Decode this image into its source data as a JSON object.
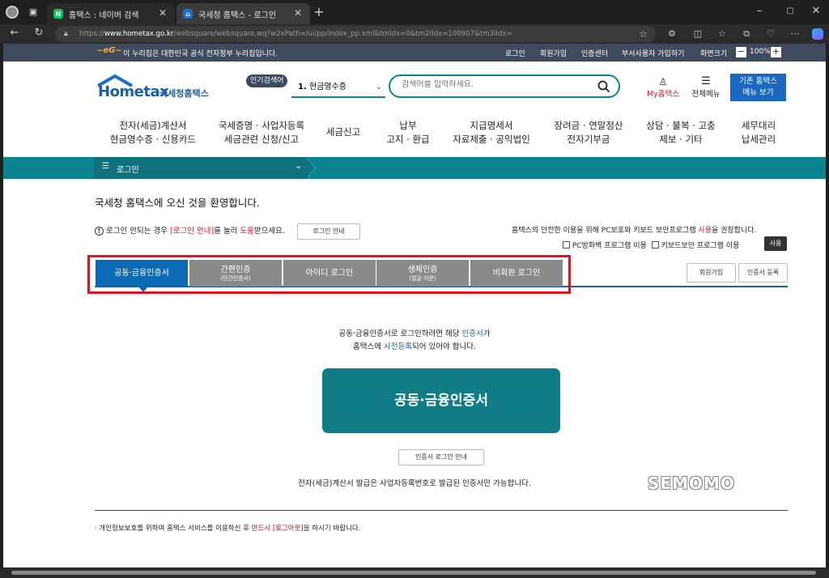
{
  "browser": {
    "tabs": [
      {
        "label": "홈택스 : 네이버 검색",
        "favicon": "N"
      },
      {
        "label": "국세청 홈택스 - 로그인",
        "favicon": "home"
      }
    ],
    "url_prefix": "https://",
    "url_host": "www.hometax.go.kr",
    "url_path": "/websquare/websquare.wq?w2xPath=/ui/pp/index_pp.xml&tmIdx=0&tm2lIdx=100907&tm3lIdx="
  },
  "topbar": {
    "notice": "이 누리집은 대한민국 공식 전자정부 누리집입니다.",
    "links": [
      "로그인",
      "회원가입",
      "인증센터",
      "부서사용자 가입하기",
      "화면크기"
    ],
    "zoom": "100%"
  },
  "header": {
    "logo_text": "Hometax",
    "logo_sub": "국세청홈택스",
    "popular_label": "인기검색어",
    "popular_rank": "1.",
    "popular_term": "현금영수증",
    "search_placeholder": "검색어를 입력하세요.",
    "my_label": "My홈택스",
    "menu_label": "전체메뉴",
    "legacy_btn_line1": "기존 홈택스",
    "legacy_btn_line2": "메뉴 보기"
  },
  "gnb": [
    {
      "line1": "전자(세금)계산서",
      "line2": "현금영수증 · 신용카드"
    },
    {
      "line1": "국세증명 · 사업자등록",
      "line2": "세금관련 신청/신고"
    },
    {
      "line1": "세금신고",
      "line2": ""
    },
    {
      "line1": "납부",
      "line2": "고지 · 환급"
    },
    {
      "line1": "지급명세서",
      "line2": "자료제출 · 공익법인"
    },
    {
      "line1": "장려금 · 연말정산",
      "line2": "전자기부금"
    },
    {
      "line1": "상담 · 불복 · 고충",
      "line2": "제보 · 기타"
    },
    {
      "line1": "세무대리",
      "line2": "납세관리"
    }
  ],
  "breadcrumb": "로그인",
  "content": {
    "welcome": "국세청 홈택스에 오신 것을 환영합니다.",
    "help_prefix": "로그인 안되는 경우 ",
    "help_link": "[로그인 안내]",
    "help_mid": "를 눌러 ",
    "help_highlight": "도움",
    "help_suffix": "받으세요.",
    "help_button": "로그인 안내",
    "security_text_a": "홈택스의 안전한 이용을 위해 PC보호와 키보드 보안프로그램 ",
    "security_highlight": "사용",
    "security_text_b": "을 권장합니다.",
    "pc_firewall": "PC방화벽 프로그램 이용",
    "keyboard_security": "키보드보안 프로그램 이용",
    "use_button": "사용",
    "login_tabs": [
      {
        "label": "공동·금융인증서",
        "sub": ""
      },
      {
        "label": "간편인증",
        "sub": "(민간인증서)"
      },
      {
        "label": "아이디 로그인",
        "sub": ""
      },
      {
        "label": "생체인증",
        "sub": "(얼굴·지문)"
      },
      {
        "label": "비회원 로그인",
        "sub": ""
      }
    ],
    "signup_button": "회원가입",
    "cert_register_button": "인증서 등록",
    "info_line1_a": "공동·금융인증서로 로그인하려면 해당 ",
    "info_line1_link": "인증서",
    "info_line1_b": "가",
    "info_line2_a": "홈택스에 ",
    "info_line2_link": "사전등록",
    "info_line2_b": "되어 있어야 합니다.",
    "big_button": "공동·금융인증서",
    "cert_guide_button": "인증서 로그인 안내",
    "note": "전자(세금)계산서 발급은 사업자등록번호로 발급된 인증서만 가능합니다.",
    "watermark": "SEMOMO",
    "footer_a": "· 개인정보보호를 위하여 홈택스 서비스를 이용하신 후 ",
    "footer_highlight": "반드시 [로그아웃]",
    "footer_b": "을 하시기 바랍니다."
  },
  "colors": {
    "teal": "#0c8390",
    "dark_teal": "#0f7c86",
    "active_tab": "#0c69b4",
    "red_highlight": "#e0141e",
    "link_blue": "#1a5fb4",
    "nav_bg": "#3f4a5e"
  }
}
